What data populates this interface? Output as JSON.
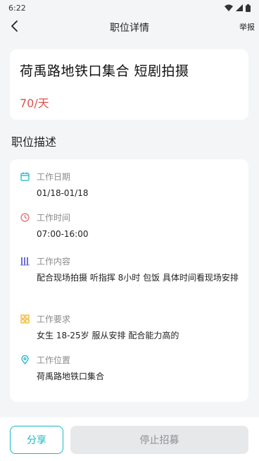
{
  "status_bar": {
    "time": "6:22"
  },
  "nav": {
    "title": "职位详情",
    "report_label": "举报"
  },
  "job": {
    "title": "荷禹路地铁口集合 短剧拍摄",
    "salary": "70/天"
  },
  "section": {
    "title": "职位描述"
  },
  "details": [
    {
      "icon": "calendar-icon",
      "label": "工作日期",
      "value": "01/18-01/18"
    },
    {
      "icon": "clock-icon",
      "label": "工作时间",
      "value": "07:00-16:00"
    },
    {
      "icon": "bars-icon",
      "label": "工作内容",
      "value": "配合现场拍摄 听指挥 8小时 包饭 具体时间看现场安排"
    },
    {
      "icon": "grid-icon",
      "label": "工作要求",
      "value": "女生 18-25岁 服从安排 配合能力高的"
    },
    {
      "icon": "location-pin-icon",
      "label": "工作位置",
      "value": "荷禹路地铁口集合"
    }
  ],
  "actions": {
    "share_label": "分享",
    "stop_label": "停止招募"
  },
  "colors": {
    "accent": "#19b6c9",
    "salary": "#d9534f"
  }
}
